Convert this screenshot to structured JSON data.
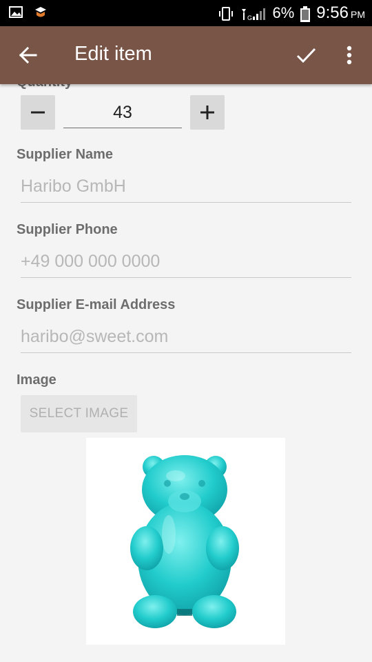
{
  "status_bar": {
    "icons_left": [
      "gallery-icon",
      "app-notification-icon"
    ],
    "icons_right": [
      "vibrate-icon",
      "signal-icon"
    ],
    "battery_percent": "6%",
    "time": "9:56",
    "ampm": "PM"
  },
  "app_bar": {
    "title": "Edit item",
    "back_icon": "arrow-left-icon",
    "save_icon": "check-icon",
    "menu_icon": "more-vert-icon"
  },
  "form": {
    "quantity": {
      "label": "Quantity",
      "value": "43",
      "decrement": "minus-icon",
      "increment": "plus-icon"
    },
    "supplier_name": {
      "label": "Supplier Name",
      "placeholder": "Haribo GmbH"
    },
    "supplier_phone": {
      "label": "Supplier Phone",
      "placeholder": "+49 000 000 0000"
    },
    "supplier_email": {
      "label": "Supplier E-mail Address",
      "placeholder": "haribo@sweet.com"
    },
    "image": {
      "label": "Image",
      "button_label": "SELECT IMAGE",
      "preview": "gummy-bear-image"
    }
  },
  "colors": {
    "app_bar": "#795548",
    "status_bar": "#000000",
    "background": "#f4f4f4",
    "label": "#6d6d6d",
    "hint": "#b7b7b7",
    "gummy_bear": "#1ec8c8"
  }
}
